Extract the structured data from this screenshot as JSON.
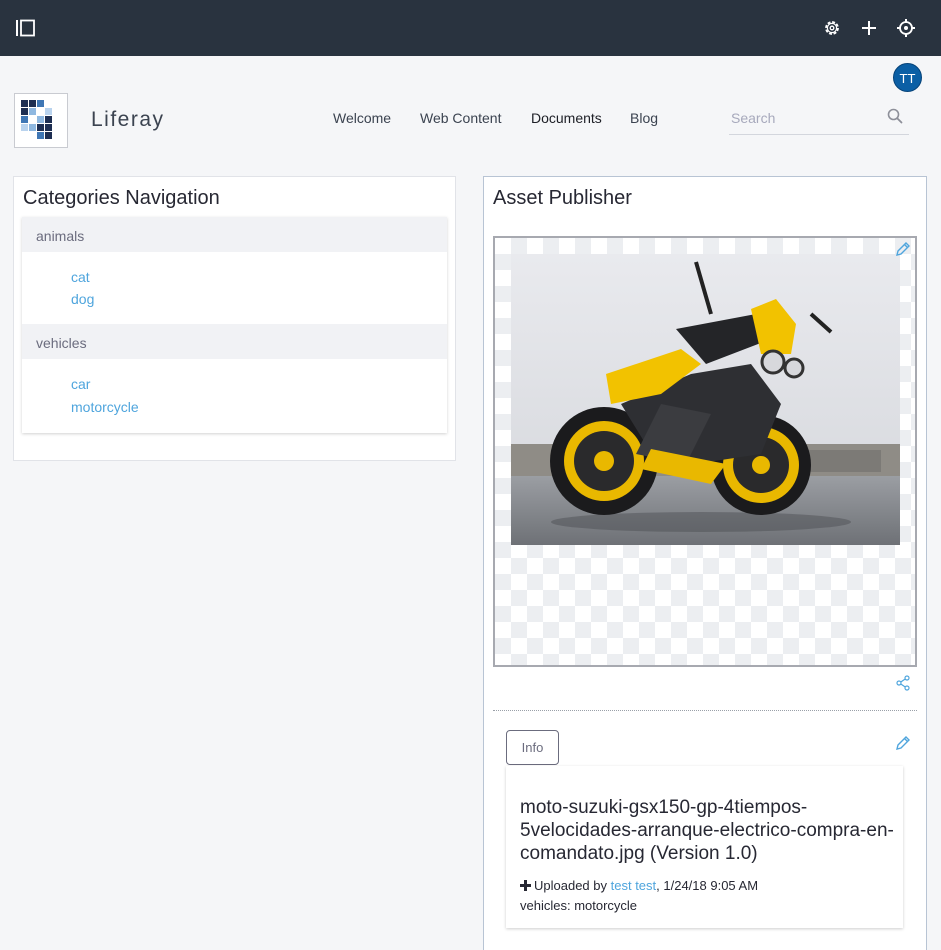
{
  "site": {
    "name": "Liferay",
    "user_initials": "TT"
  },
  "nav": {
    "items": [
      "Welcome",
      "Web Content",
      "Documents",
      "Blog"
    ],
    "active": "Documents"
  },
  "search": {
    "placeholder": "Search"
  },
  "categories_portlet": {
    "title": "Categories Navigation",
    "vocabularies": [
      {
        "name": "animals",
        "categories": [
          "cat",
          "dog"
        ]
      },
      {
        "name": "vehicles",
        "categories": [
          "car",
          "motorcycle"
        ]
      }
    ]
  },
  "asset_publisher": {
    "title": "Asset Publisher",
    "info_button": "Info",
    "document": {
      "title": "moto-suzuki-gsx150-gp-4tiempos-5velocidades-arranque-electrico-compra-en-comandato.jpg (Version 1.0)",
      "uploaded_prefix": "Uploaded by",
      "uploader": "test test",
      "uploaded_suffix": ", 1/24/18 9:05 AM",
      "category_line": "vehicles: motorcycle"
    }
  },
  "icons": {
    "sidebar_toggle": "sidebar-toggle-icon",
    "settings": "gear-icon",
    "add": "plus-icon",
    "simulation": "target-icon",
    "search": "search-icon",
    "edit": "pencil-icon",
    "share": "share-icon",
    "uploaded": "plus-icon"
  },
  "colors": {
    "topbar": "#29333f",
    "avatar": "#0b5fa5",
    "link": "#4fa5dd"
  }
}
